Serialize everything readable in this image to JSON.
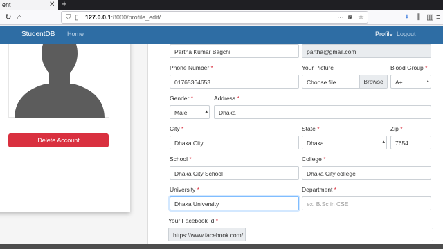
{
  "browser": {
    "tab_title": "ent",
    "url_host": "127.0.0.1",
    "url_path": ":8000/profile_edit/",
    "icons": {
      "close": "close-icon",
      "new_tab": "plus-icon",
      "reload": "reload-icon",
      "home": "home-icon",
      "shield": "shield-icon",
      "page": "page-icon",
      "more": "ellipsis-icon",
      "pocket": "pocket-icon",
      "star": "star-icon",
      "download": "download-icon",
      "library": "library-icon",
      "sidebar": "sidebar-icon",
      "menu": "hamburger-icon"
    }
  },
  "app": {
    "brand": "StudentDB",
    "nav_home": "Home",
    "nav_profile": "Profile",
    "nav_logout": "Logout",
    "brand_color": "#2e6da4"
  },
  "profile_card": {
    "delete_label": "Delete Account",
    "delete_color": "#d9303f"
  },
  "form": {
    "name_value": "Partha Kumar Bagchi",
    "email_value": "partha@gmail.com",
    "phone_label": "Phone Number",
    "phone_value": "01765364653",
    "picture_label": "Your Picture",
    "picture_placeholder": "Choose file",
    "picture_browse": "Browse",
    "blood_label": "Blood Group",
    "blood_value": "A+",
    "gender_label": "Gender",
    "gender_value": "Male",
    "address_label": "Address",
    "address_value": "Dhaka",
    "city_label": "City",
    "city_value": "Dhaka City",
    "state_label": "State",
    "state_value": "Dhaka",
    "zip_label": "Zip",
    "zip_value": "7654",
    "school_label": "School",
    "school_value": "Dhaka City School",
    "college_label": "College",
    "college_value": "Dhaka City college",
    "university_label": "University",
    "university_value": "Dhaka University",
    "department_label": "Department",
    "department_placeholder": "ex. B.Sc in CSE",
    "facebook_label": "Your Facebook Id",
    "facebook_prefix": "https://www.facebook.com/",
    "required_mark": "*"
  }
}
